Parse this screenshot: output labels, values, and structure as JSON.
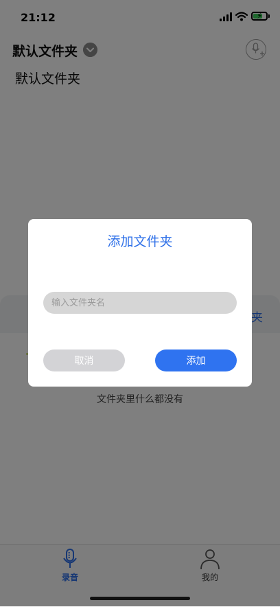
{
  "status": {
    "time": "21:12"
  },
  "header": {
    "title": "默认文件夹"
  },
  "folder_list": {
    "items": [
      "默认文件夹"
    ]
  },
  "background_sheet": {
    "partial_text": "夹"
  },
  "empty_state": {
    "text": "文件夹里什么都没有"
  },
  "dialog": {
    "title": "添加文件夹",
    "input_placeholder": "输入文件夹名",
    "input_value": "",
    "cancel_label": "取消",
    "add_label": "添加"
  },
  "tabbar": {
    "tabs": [
      {
        "label": "录音",
        "active": true,
        "icon": "microphone-icon"
      },
      {
        "label": "我的",
        "active": false,
        "icon": "person-icon"
      }
    ]
  },
  "colors": {
    "accent": "#2f73f0",
    "battery": "#3dd05a"
  }
}
